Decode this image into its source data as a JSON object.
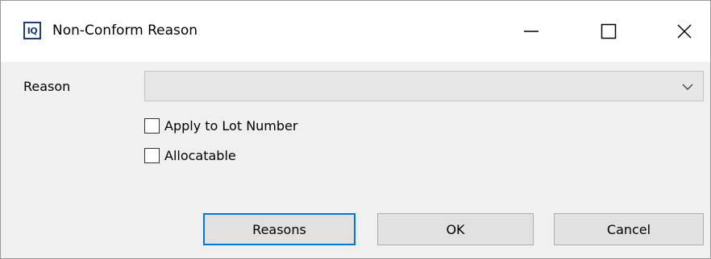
{
  "window": {
    "title": "Non-Conform Reason",
    "app_icon_text": "IQ",
    "controls": [
      "minimize-icon",
      "maximize-icon",
      "close-icon"
    ]
  },
  "form": {
    "reason_label": "Reason",
    "reason_value": "",
    "apply_lot_label": "Apply to Lot Number",
    "apply_lot_checked": false,
    "allocatable_label": "Allocatable",
    "allocatable_checked": false
  },
  "buttons": {
    "reasons": "Reasons",
    "ok": "OK",
    "cancel": "Cancel"
  },
  "colors": {
    "default_button_border": "#0078d7",
    "dialog_background": "#f0f0f0"
  }
}
